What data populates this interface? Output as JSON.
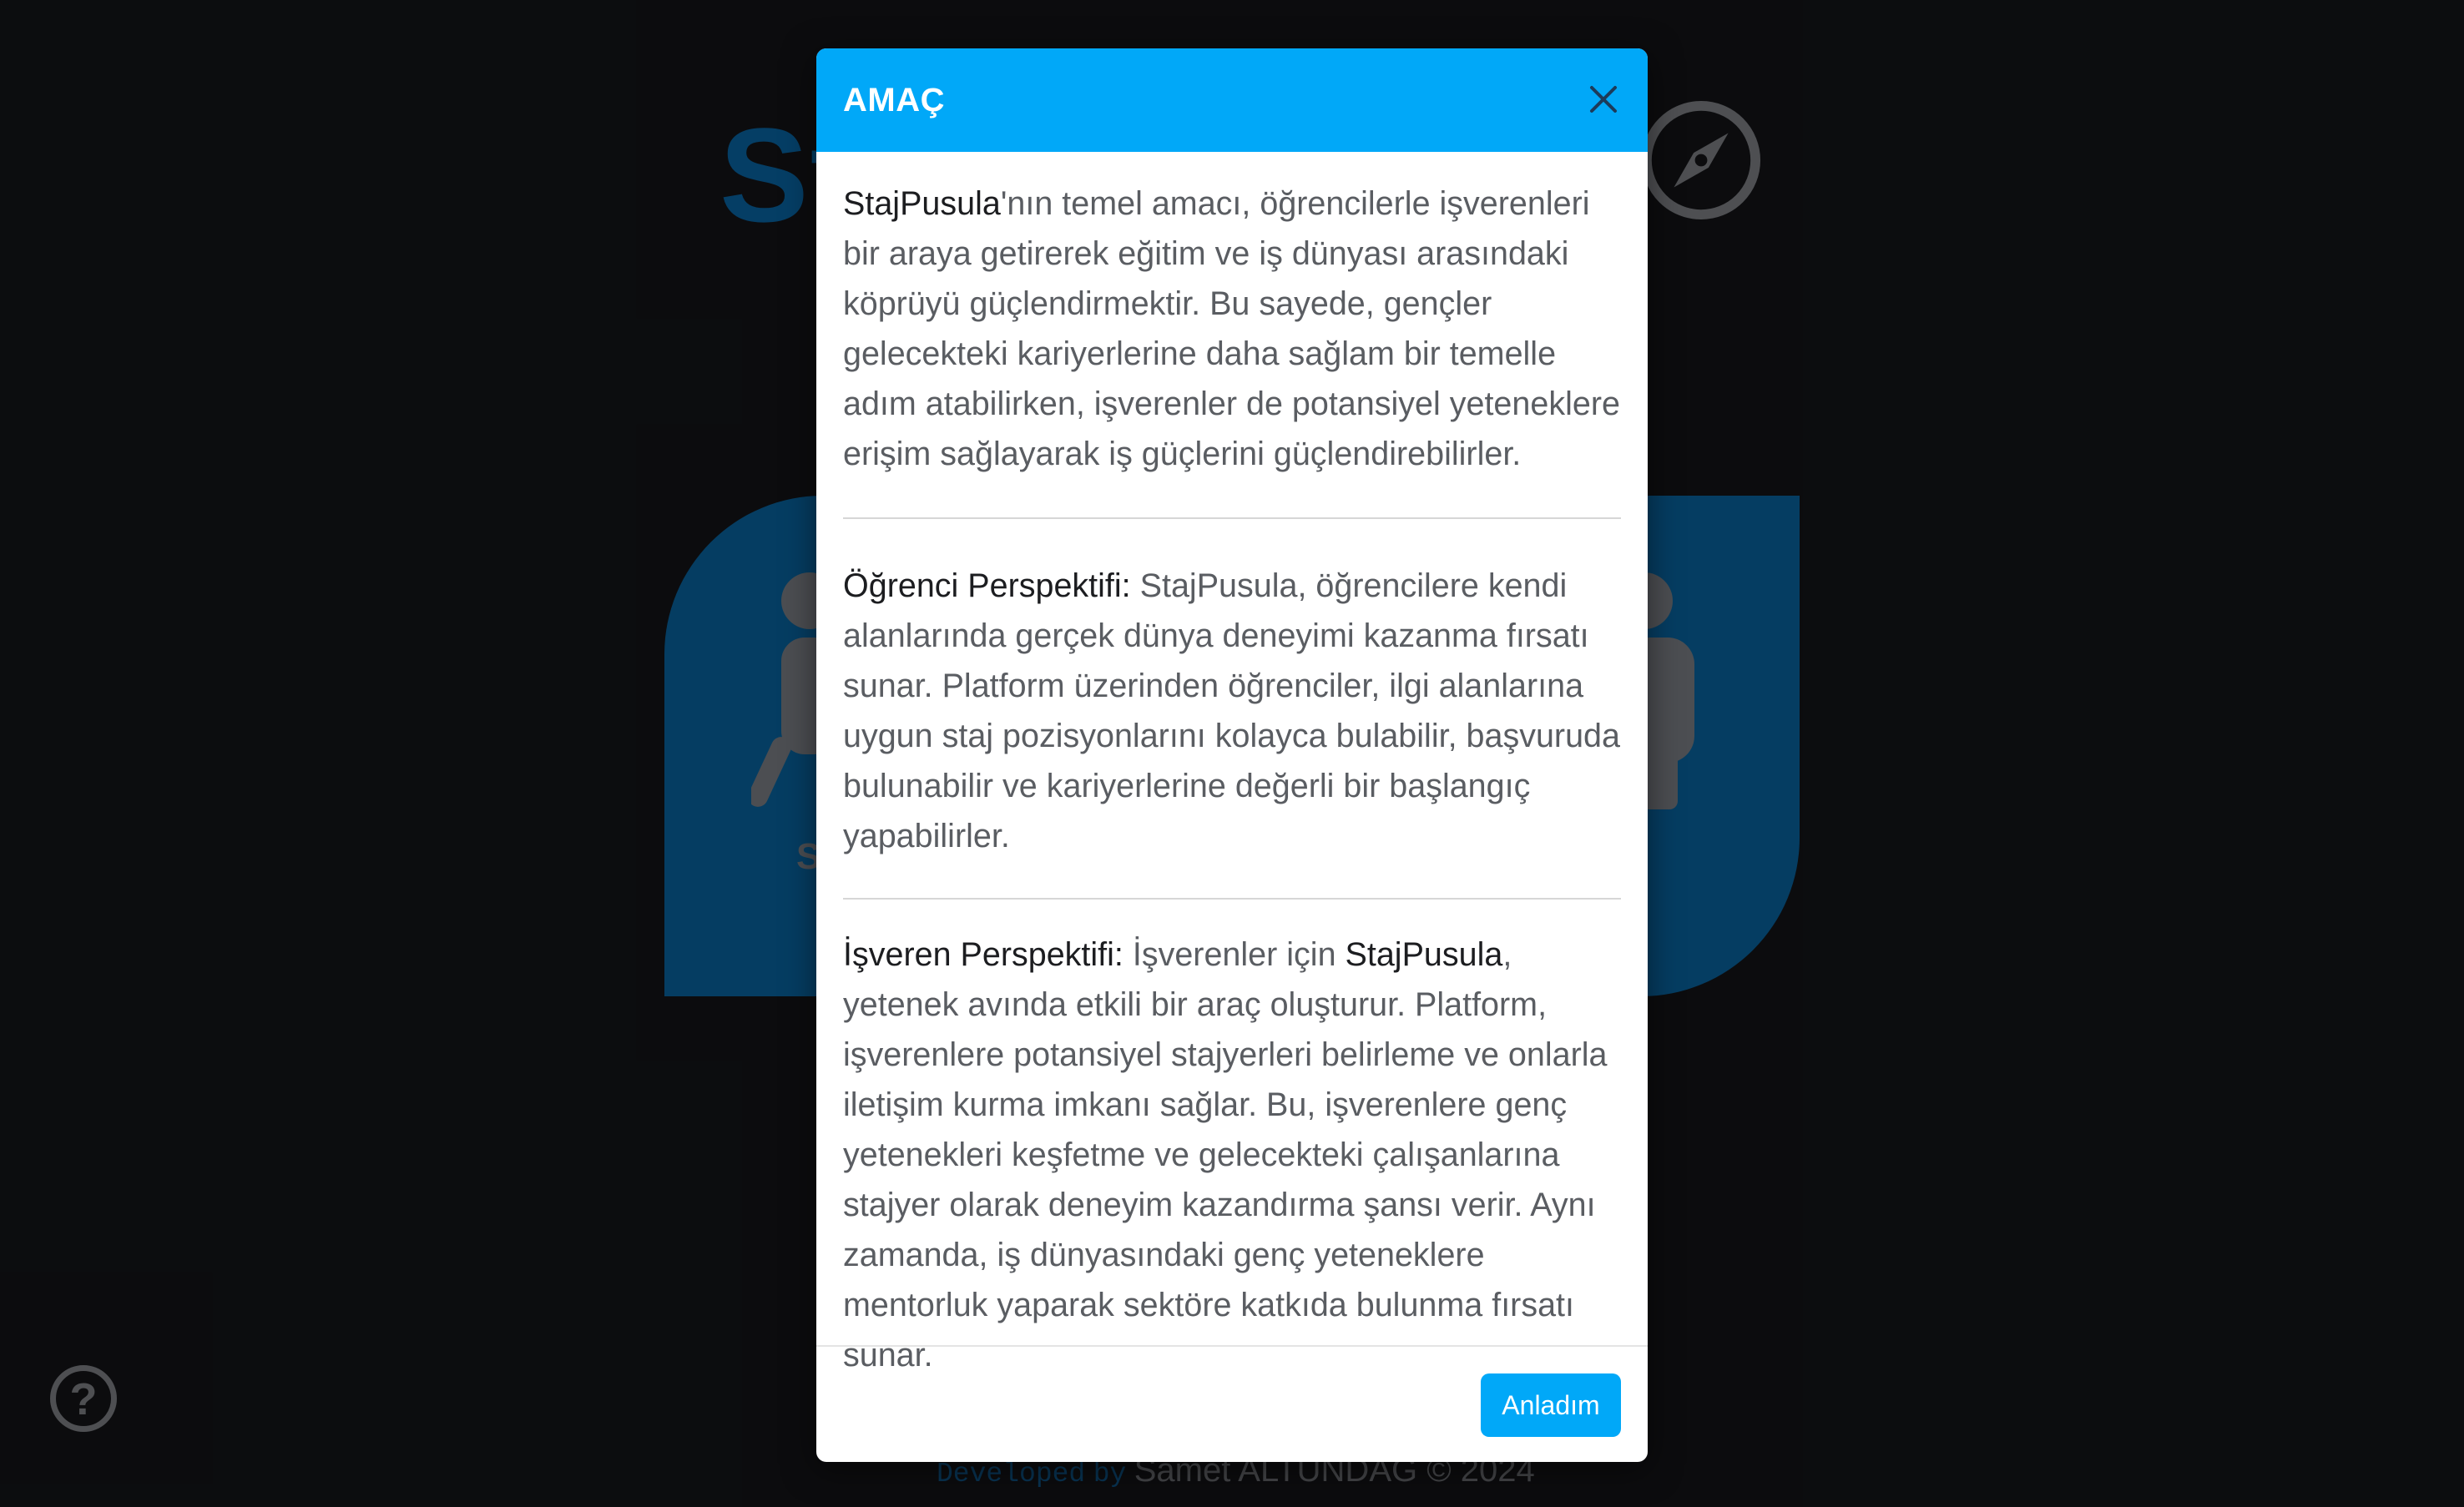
{
  "background": {
    "logo_text": "St",
    "card_left_text": "S",
    "card_right_text": "",
    "help_icon": "question-circle-icon",
    "compass_icon": "compass-icon",
    "footer": {
      "developed": "Developed",
      "by": "by",
      "author": "Samet ALTUNDAĞ © 2024"
    }
  },
  "modal": {
    "title": "AMAÇ",
    "close_icon": "close-icon",
    "paragraphs": {
      "purpose": {
        "brand": "StajPusula",
        "text": "'nın temel amacı, öğrencilerle işverenleri bir araya getirerek eğitim ve iş dünyası arasındaki köprüyü güçlendirmektir. Bu sayede, gençler gelecekteki kariyerlerine daha sağlam bir temelle adım atabilirken, işverenler de potansiyel yeteneklere erişim sağlayarak iş güçlerini güçlendirebilirler."
      },
      "student": {
        "heading": "Öğrenci Perspektifi:",
        "text": " StajPusula, öğrencilere kendi alanlarında gerçek dünya deneyimi kazanma fırsatı sunar. Platform üzerinden öğrenciler, ilgi alanlarına uygun staj pozisyonlarını kolayca bulabilir, başvuruda bulunabilir ve kariyerlerine değerli bir başlangıç yapabilirler."
      },
      "employer": {
        "heading": "İşveren Perspektifi:",
        "text_before": " İşverenler için ",
        "brand": "StajPusula",
        "text_after": ", yetenek avında etkili bir araç oluşturur. Platform, işverenlere potansiyel stajyerleri belirleme ve onlarla iletişim kurma imkanı sağlar. Bu, işverenlere genç yetenekleri keşfetme ve gelecekteki çalışanlarına stajyer olarak deneyim kazandırma şansı verir. Aynı zamanda, iş dünyasındaki genç yeteneklere mentorluk yaparak sektöre katkıda bulunma fırsatı sunar."
      }
    },
    "ok_button_label": "Anladım"
  },
  "colors": {
    "accent": "#01a8f8",
    "background": "#16171b",
    "brand_blue": "#0a70b3"
  }
}
